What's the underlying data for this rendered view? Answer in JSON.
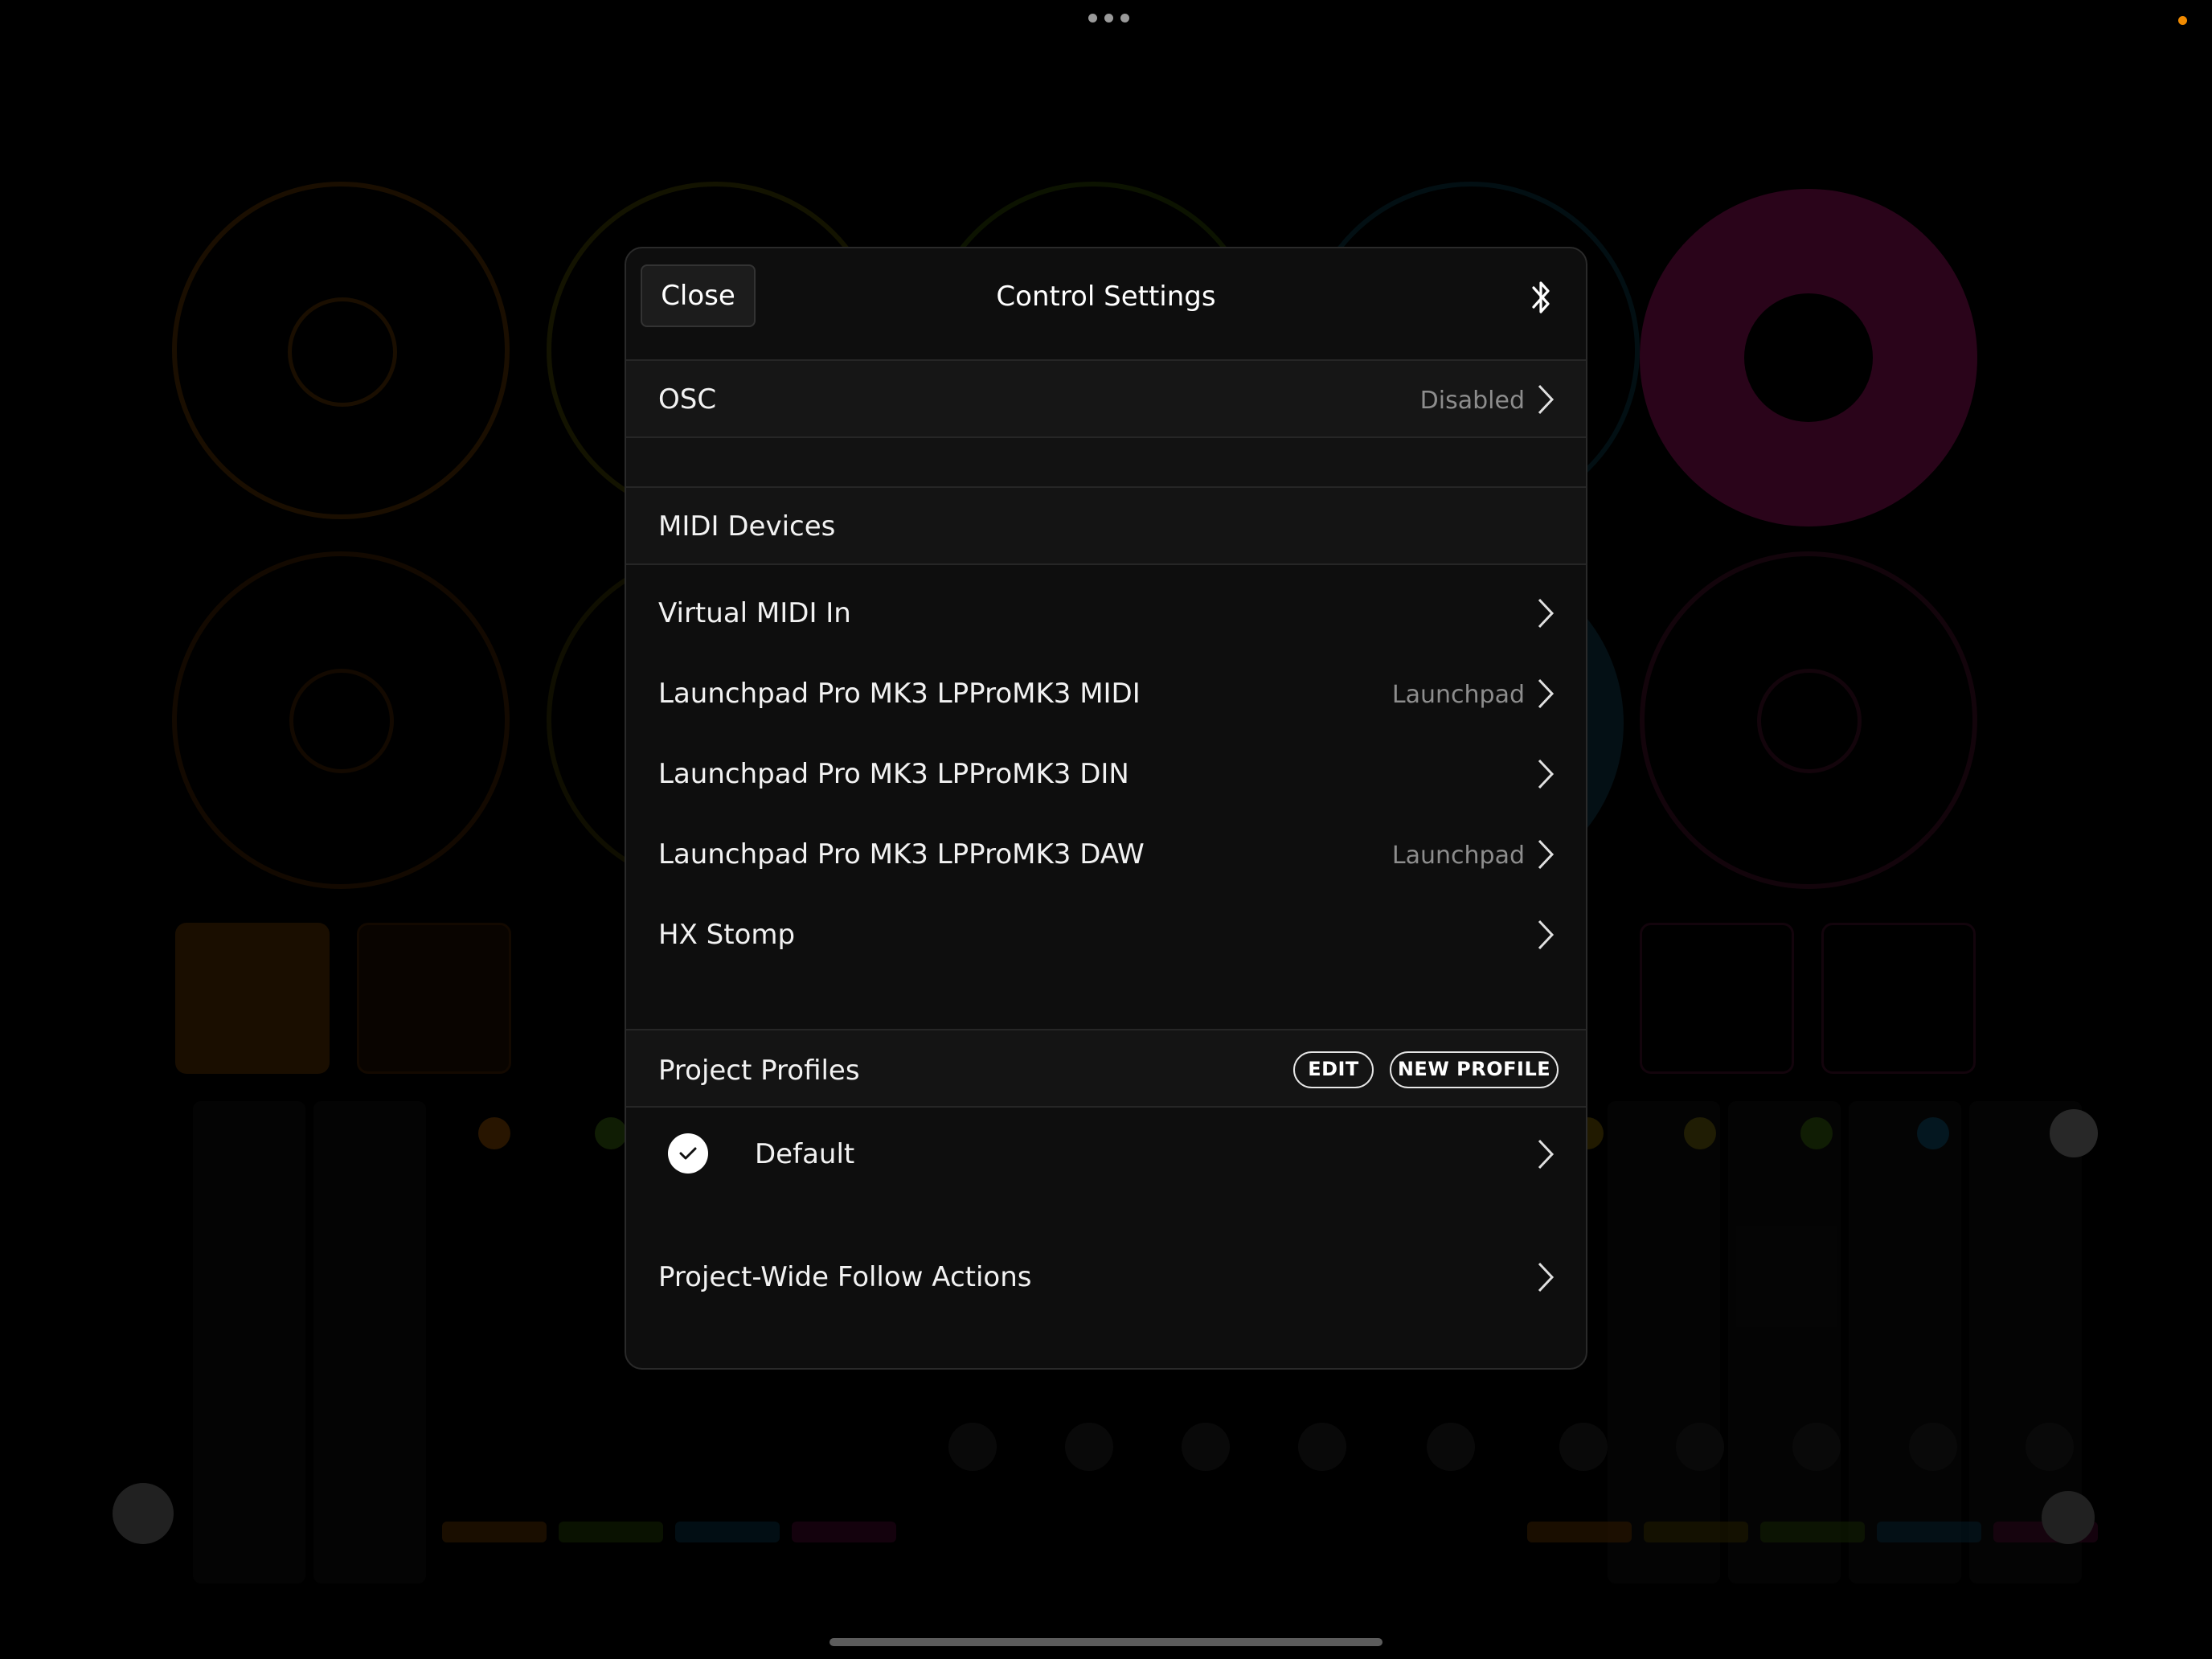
{
  "dialog": {
    "close_label": "Close",
    "title": "Control Settings",
    "bluetooth_icon": "bluetooth-icon"
  },
  "osc": {
    "label": "OSC",
    "value": "Disabled"
  },
  "midi": {
    "header": "MIDI Devices",
    "devices": [
      {
        "label": "Virtual MIDI In",
        "value": ""
      },
      {
        "label": "Launchpad Pro MK3 LPProMK3 MIDI",
        "value": "Launchpad"
      },
      {
        "label": "Launchpad Pro MK3 LPProMK3 DIN",
        "value": ""
      },
      {
        "label": "Launchpad Pro MK3 LPProMK3 DAW",
        "value": "Launchpad"
      },
      {
        "label": "HX Stomp",
        "value": ""
      }
    ]
  },
  "profiles": {
    "header": "Project Profiles",
    "edit_label": "EDIT",
    "new_label": "NEW PROFILE",
    "items": [
      {
        "label": "Default",
        "selected": true
      }
    ]
  },
  "follow_actions": {
    "label": "Project-Wide Follow Actions"
  },
  "colors": {
    "accent_orange": "#f08a00",
    "pink": "#c4177a",
    "modal_bg": "#0e0e0e"
  }
}
